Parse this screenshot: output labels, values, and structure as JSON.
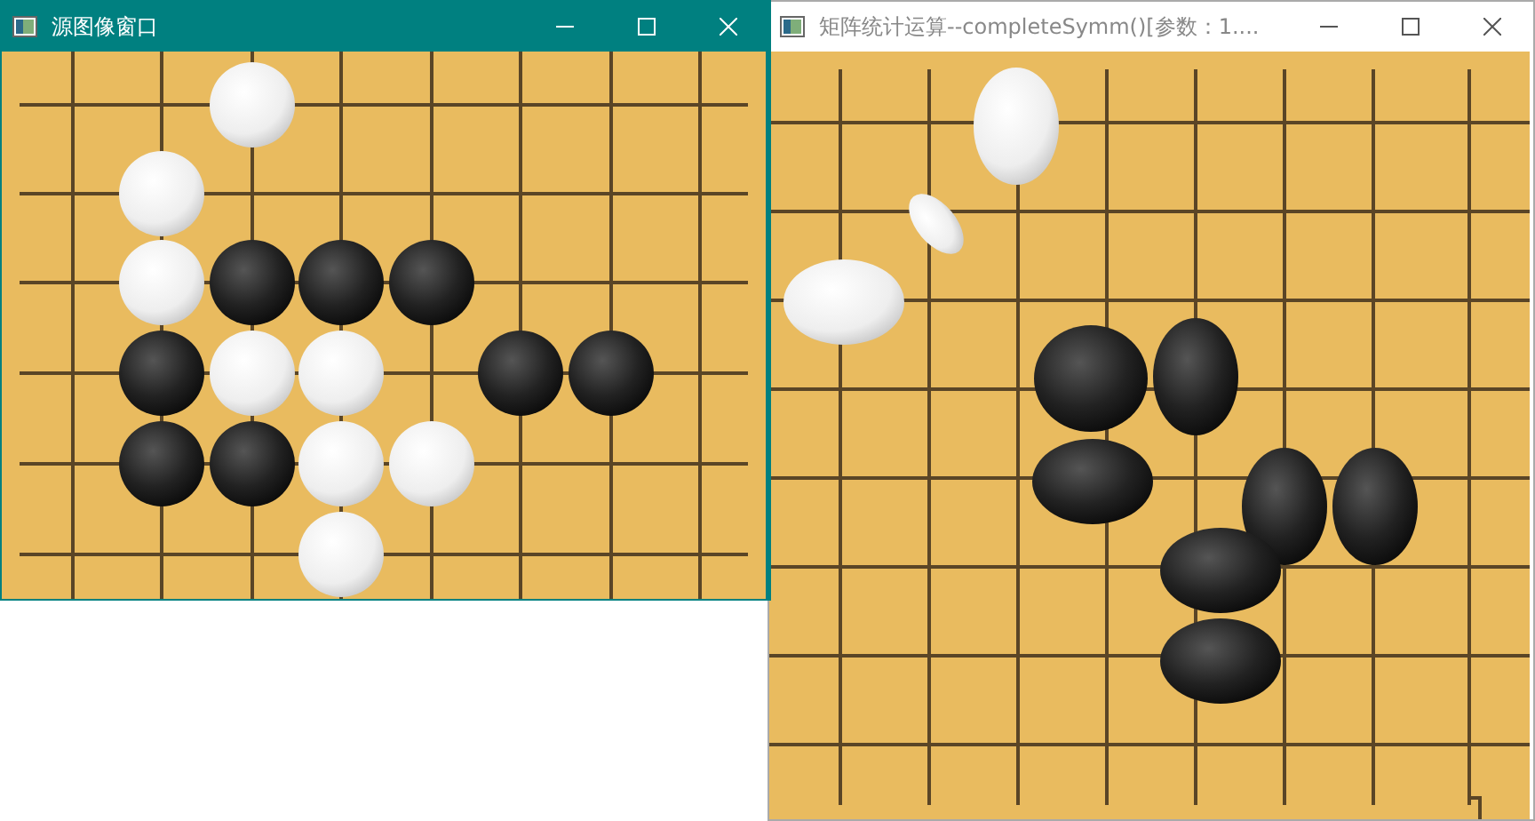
{
  "windows": [
    {
      "title": "源图像窗口",
      "active": true,
      "kind": "grid-board"
    },
    {
      "title": "矩阵统计运算--completeSymm()[参数：1....",
      "active": false,
      "kind": "warped-board"
    }
  ]
}
